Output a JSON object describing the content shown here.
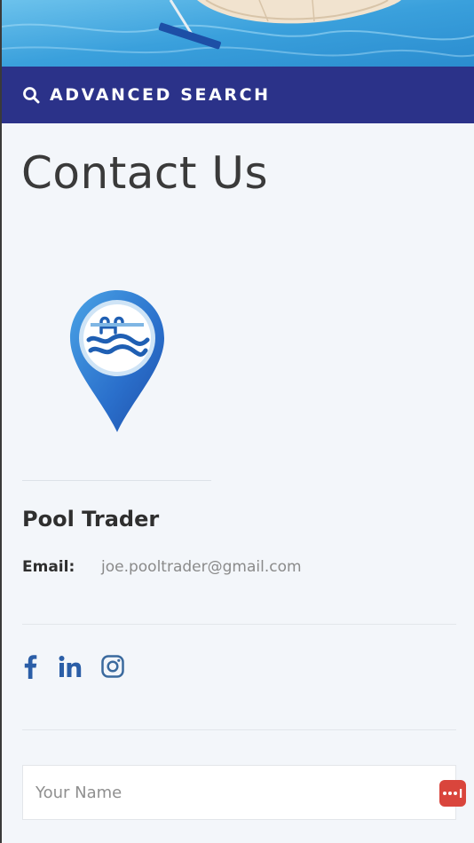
{
  "header": {
    "search_label": "ADVANCED SEARCH",
    "search_icon": "search-icon"
  },
  "page": {
    "title": "Contact Us"
  },
  "contact": {
    "company_name": "Pool Trader",
    "email_label": "Email:",
    "email_value": "joe.pooltrader@gmail.com",
    "logo_icon": "pool-location-pin-logo"
  },
  "social": [
    {
      "name": "facebook",
      "icon": "facebook-icon"
    },
    {
      "name": "linkedin",
      "icon": "linkedin-icon"
    },
    {
      "name": "instagram",
      "icon": "instagram-icon"
    }
  ],
  "form": {
    "name_placeholder": "Your Name",
    "name_value": ""
  },
  "colors": {
    "header_bar": "#2b3289",
    "social_blue": "#2b5ea7",
    "password_manager": "#d9453c"
  }
}
